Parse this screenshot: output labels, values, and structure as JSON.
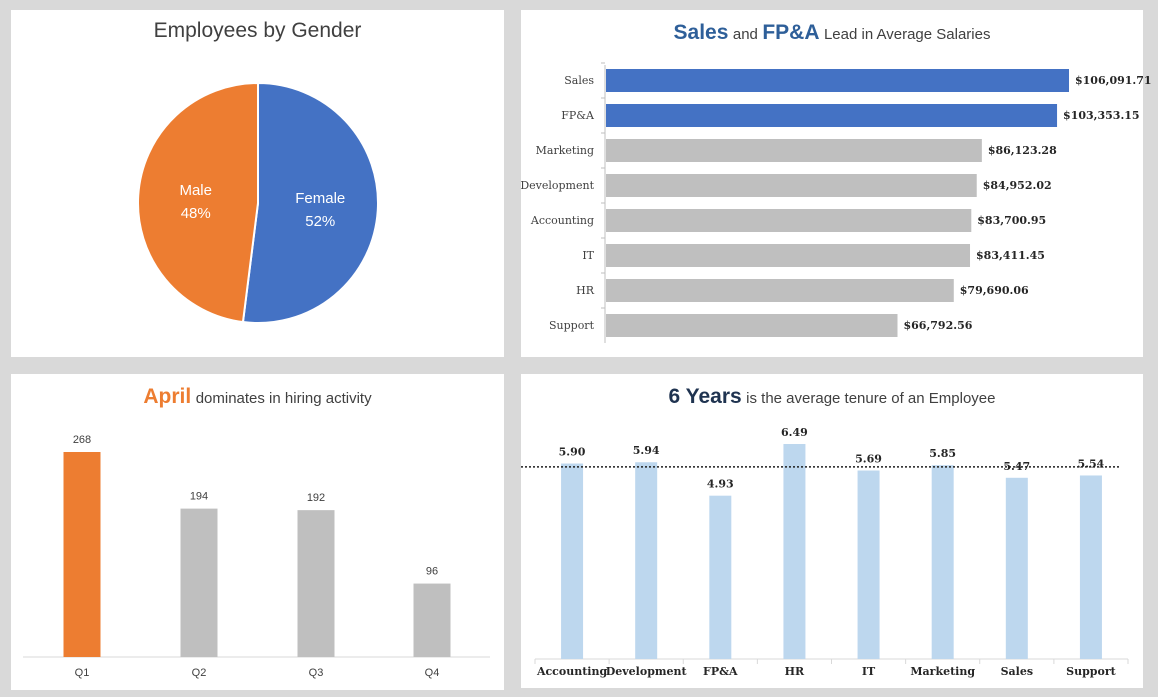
{
  "panels": {
    "gender": {
      "title": "Employees by Gender"
    },
    "salaries": {
      "title_parts": [
        "Sales",
        "and",
        "FP&A",
        "Lead in Average Salaries"
      ]
    },
    "hiring": {
      "title_parts": [
        "April",
        "dominates in hiring activity"
      ]
    },
    "tenure": {
      "title_parts": [
        "6 Years",
        "is the average tenure of an Employee"
      ]
    }
  },
  "colors": {
    "orange": "#ed7d31",
    "blue": "#4472c4",
    "gray": "#bfbfbf",
    "lightblue": "#bdd7ee",
    "title_blue": "#2e5f99",
    "title_navy": "#1f3350"
  },
  "chart_data": [
    {
      "type": "pie",
      "title": "Employees by Gender",
      "slices": [
        {
          "label": "Female",
          "value": 52,
          "display": "52%",
          "color": "#4472c4"
        },
        {
          "label": "Male",
          "value": 48,
          "display": "48%",
          "color": "#ed7d31"
        }
      ]
    },
    {
      "type": "bar",
      "orientation": "horizontal",
      "title": "Sales and FP&A Lead in Average Salaries",
      "categories": [
        "Sales",
        "FP&A",
        "Marketing",
        "Development",
        "Accounting",
        "IT",
        "HR",
        "Support"
      ],
      "values": [
        106091.71,
        103353.15,
        86123.28,
        84952.02,
        83700.95,
        83411.45,
        79690.06,
        66792.56
      ],
      "labels": [
        "$106,091.71",
        "$103,353.15",
        "$86,123.28",
        "$84,952.02",
        "$83,700.95",
        "$83,411.45",
        "$79,690.06",
        "$66,792.56"
      ],
      "highlight": [
        "Sales",
        "FP&A"
      ]
    },
    {
      "type": "bar",
      "title": "April dominates in hiring activity",
      "categories": [
        "Q1",
        "Q2",
        "Q3",
        "Q4"
      ],
      "values": [
        268,
        194,
        192,
        96
      ],
      "labels": [
        "268",
        "194",
        "192",
        "96"
      ],
      "highlight": [
        "Q1"
      ],
      "ylim": [
        0,
        300
      ]
    },
    {
      "type": "bar",
      "title": "6 Years is the average tenure of an Employee",
      "categories": [
        "Accounting",
        "Development",
        "FP&A",
        "HR",
        "IT",
        "Marketing",
        "Sales",
        "Support"
      ],
      "values": [
        5.9,
        5.94,
        4.93,
        6.49,
        5.69,
        5.85,
        5.47,
        5.54
      ],
      "labels": [
        "5.90",
        "5.94",
        "4.93",
        "6.49",
        "5.69",
        "5.85",
        "5.47",
        "5.54"
      ],
      "reference_line": 5.8,
      "ylim": [
        0,
        6.8
      ]
    }
  ]
}
